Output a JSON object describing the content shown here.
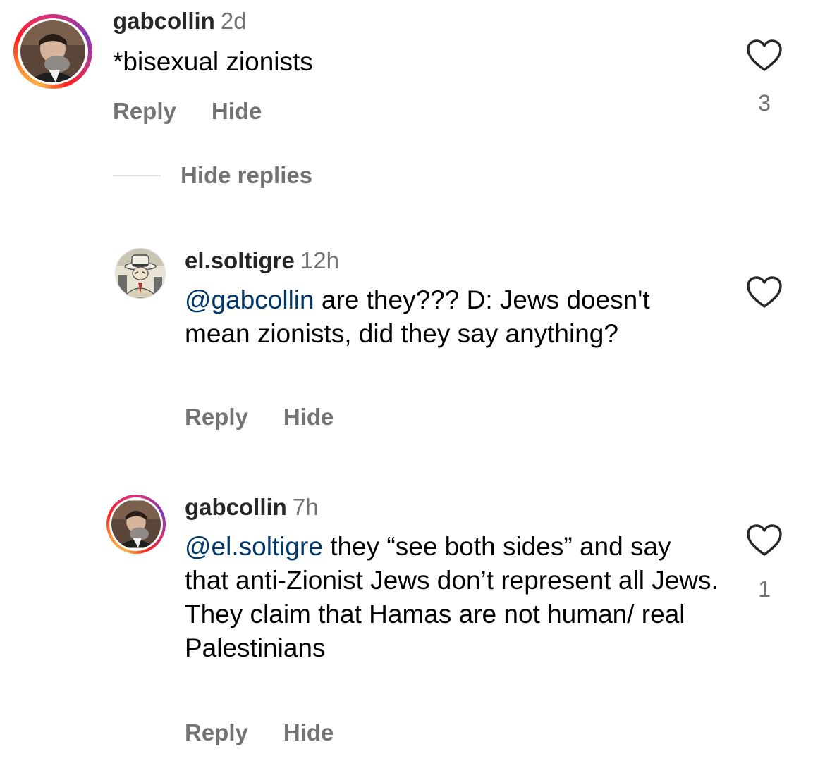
{
  "comments": [
    {
      "username": "gabcollin",
      "time": "2d",
      "text": "*bisexual zionists",
      "likes": "3",
      "reply_label": "Reply",
      "hide_label": "Hide"
    },
    {
      "username": "el.soltigre",
      "time": "12h",
      "mention": "@gabcollin",
      "text": " are they??? D: Jews doesn't mean zionists, did they say anything?",
      "likes": "",
      "reply_label": "Reply",
      "hide_label": "Hide"
    },
    {
      "username": "gabcollin",
      "time": "7h",
      "mention": "@el.soltigre",
      "text": " they “see both sides” and say that anti-Zionist Jews don’t represent all Jews. They claim that Hamas are not human/ real Palestinians",
      "likes": "1",
      "reply_label": "Reply",
      "hide_label": "Hide"
    }
  ],
  "thread": {
    "hide_replies_label": "Hide replies"
  },
  "colors": {
    "username": "#262626",
    "secondary": "#737373",
    "mention": "#00376b",
    "divider": "#dbdbdb"
  },
  "icons": {
    "like": "heart-outline-icon"
  }
}
